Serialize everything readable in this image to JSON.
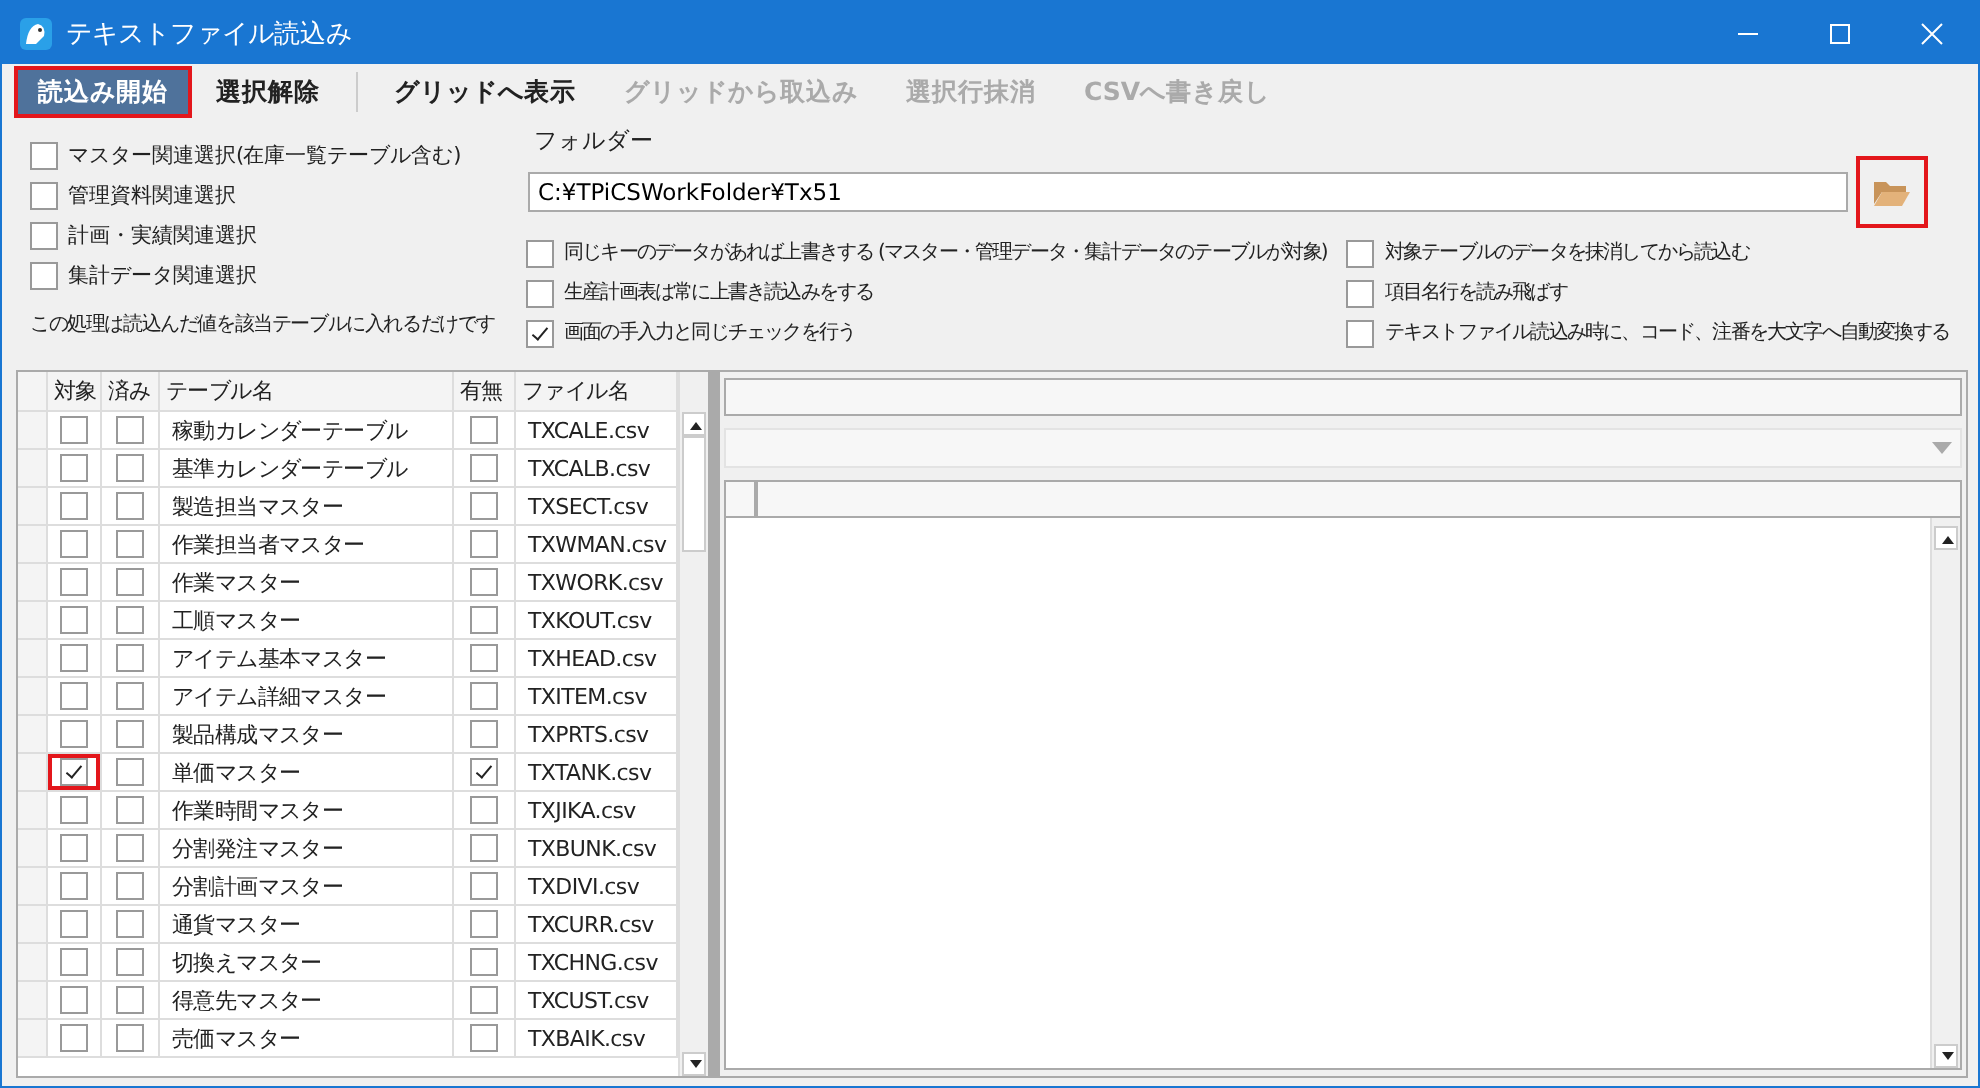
{
  "window": {
    "title": "テキストファイル読込み"
  },
  "toolbar": [
    {
      "label": "読込み開始",
      "kind": "primary",
      "disabled": false,
      "highlighted": true
    },
    {
      "label": "選択解除",
      "kind": "plain",
      "disabled": false,
      "highlighted": false
    },
    {
      "kind": "separator"
    },
    {
      "label": "グリッドへ表示",
      "kind": "plain",
      "disabled": false,
      "highlighted": false
    },
    {
      "label": "グリッドから取込み",
      "kind": "plain",
      "disabled": true,
      "highlighted": false
    },
    {
      "label": "選択行抹消",
      "kind": "plain",
      "disabled": true,
      "highlighted": false
    },
    {
      "label": "CSVへ書き戻し",
      "kind": "plain",
      "disabled": true,
      "highlighted": false
    }
  ],
  "selection_options": [
    {
      "label": "マスター関連選択(在庫一覧テーブル含む)",
      "checked": false
    },
    {
      "label": "管理資料関連選択",
      "checked": false
    },
    {
      "label": "計画・実績関連選択",
      "checked": false
    },
    {
      "label": "集計データ関連選択",
      "checked": false
    }
  ],
  "note": "この処理は読込んだ値を該当テーブルに入れるだけです",
  "folder": {
    "label": "フォルダー",
    "value": "C:¥TPiCSWorkFolder¥Tx51",
    "browse_highlighted": true
  },
  "options_middle": [
    {
      "label": "同じキーのデータがあれば上書きする (マスター・管理データ・集計データのテーブルが対象)",
      "checked": false
    },
    {
      "label": "生産計画表は常に上書き読込みをする",
      "checked": false
    },
    {
      "label": "画面の手入力と同じチェックを行う",
      "checked": true
    }
  ],
  "options_right": [
    {
      "label": "対象テーブルのデータを抹消してから読込む",
      "checked": false
    },
    {
      "label": "項目名行を読み飛ばす",
      "checked": false
    },
    {
      "label": "テキストファイル読込み時に、コード、注番を大文字へ自動変換する",
      "checked": false
    }
  ],
  "table": {
    "columns": [
      "対象",
      "済み",
      "テーブル名",
      "有無",
      "ファイル名"
    ],
    "rows": [
      {
        "target": false,
        "done": false,
        "name": "稼動カレンダーテーブル",
        "exists": false,
        "file": "TXCALE.csv",
        "highlighted": false
      },
      {
        "target": false,
        "done": false,
        "name": "基準カレンダーテーブル",
        "exists": false,
        "file": "TXCALB.csv",
        "highlighted": false
      },
      {
        "target": false,
        "done": false,
        "name": "製造担当マスター",
        "exists": false,
        "file": "TXSECT.csv",
        "highlighted": false
      },
      {
        "target": false,
        "done": false,
        "name": "作業担当者マスター",
        "exists": false,
        "file": "TXWMAN.csv",
        "highlighted": false
      },
      {
        "target": false,
        "done": false,
        "name": "作業マスター",
        "exists": false,
        "file": "TXWORK.csv",
        "highlighted": false
      },
      {
        "target": false,
        "done": false,
        "name": "工順マスター",
        "exists": false,
        "file": "TXKOUT.csv",
        "highlighted": false
      },
      {
        "target": false,
        "done": false,
        "name": "アイテム基本マスター",
        "exists": false,
        "file": "TXHEAD.csv",
        "highlighted": false
      },
      {
        "target": false,
        "done": false,
        "name": "アイテム詳細マスター",
        "exists": false,
        "file": "TXITEM.csv",
        "highlighted": false
      },
      {
        "target": false,
        "done": false,
        "name": "製品構成マスター",
        "exists": false,
        "file": "TXPRTS.csv",
        "highlighted": false
      },
      {
        "target": true,
        "done": false,
        "name": "単価マスター",
        "exists": true,
        "file": "TXTANK.csv",
        "highlighted": true
      },
      {
        "target": false,
        "done": false,
        "name": "作業時間マスター",
        "exists": false,
        "file": "TXJIKA.csv",
        "highlighted": false
      },
      {
        "target": false,
        "done": false,
        "name": "分割発注マスター",
        "exists": false,
        "file": "TXBUNK.csv",
        "highlighted": false
      },
      {
        "target": false,
        "done": false,
        "name": "分割計画マスター",
        "exists": false,
        "file": "TXDIVI.csv",
        "highlighted": false
      },
      {
        "target": false,
        "done": false,
        "name": "通貨マスター",
        "exists": false,
        "file": "TXCURR.csv",
        "highlighted": false
      },
      {
        "target": false,
        "done": false,
        "name": "切換えマスター",
        "exists": false,
        "file": "TXCHNG.csv",
        "highlighted": false
      },
      {
        "target": false,
        "done": false,
        "name": "得意先マスター",
        "exists": false,
        "file": "TXCUST.csv",
        "highlighted": false
      },
      {
        "target": false,
        "done": false,
        "name": "売価マスター",
        "exists": false,
        "file": "TXBAIK.csv",
        "highlighted": false
      }
    ]
  }
}
